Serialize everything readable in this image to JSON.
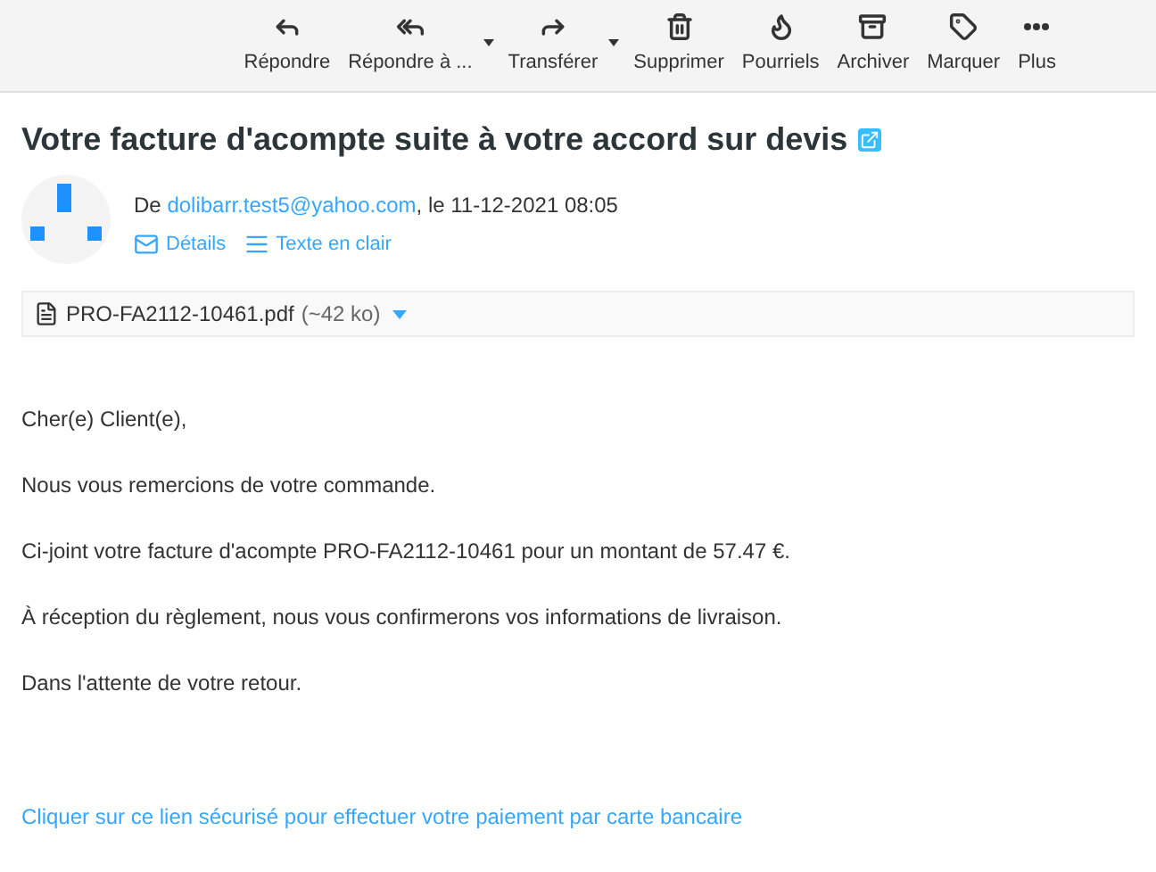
{
  "toolbar": [
    {
      "label": "Répondre",
      "has_menu": false
    },
    {
      "label": "Répondre à ...",
      "has_menu": true
    },
    {
      "label": "Transférer",
      "has_menu": true
    },
    {
      "label": "Supprimer",
      "has_menu": false
    },
    {
      "label": "Pourriels",
      "has_menu": false
    },
    {
      "label": "Archiver",
      "has_menu": false
    },
    {
      "label": "Marquer",
      "has_menu": false
    },
    {
      "label": "Plus",
      "has_menu": false
    }
  ],
  "subject": "Votre facture d'acompte suite à votre accord sur devis",
  "sender": {
    "prefix": "De",
    "email": "dolibarr.test5@yahoo.com",
    "suffix": ", le 11-12-2021 08:05"
  },
  "header_links": [
    "Détails",
    "Texte en clair"
  ],
  "attachment": {
    "name": "PRO-FA2112-10461.pdf",
    "size": "(~42 ko)"
  },
  "body": [
    "Cher(e) Client(e),",
    "Nous vous remercions de votre commande.",
    "Ci-joint votre facture d'acompte PRO-FA2112-10461 pour un montant de 57.47 €.",
    "À réception du règlement, nous vous confirmerons vos informations de livraison.",
    "Dans l'attente de votre retour."
  ],
  "payment_link": "Cliquer sur ce lien sécurisé pour effectuer votre paiement par carte bancaire"
}
